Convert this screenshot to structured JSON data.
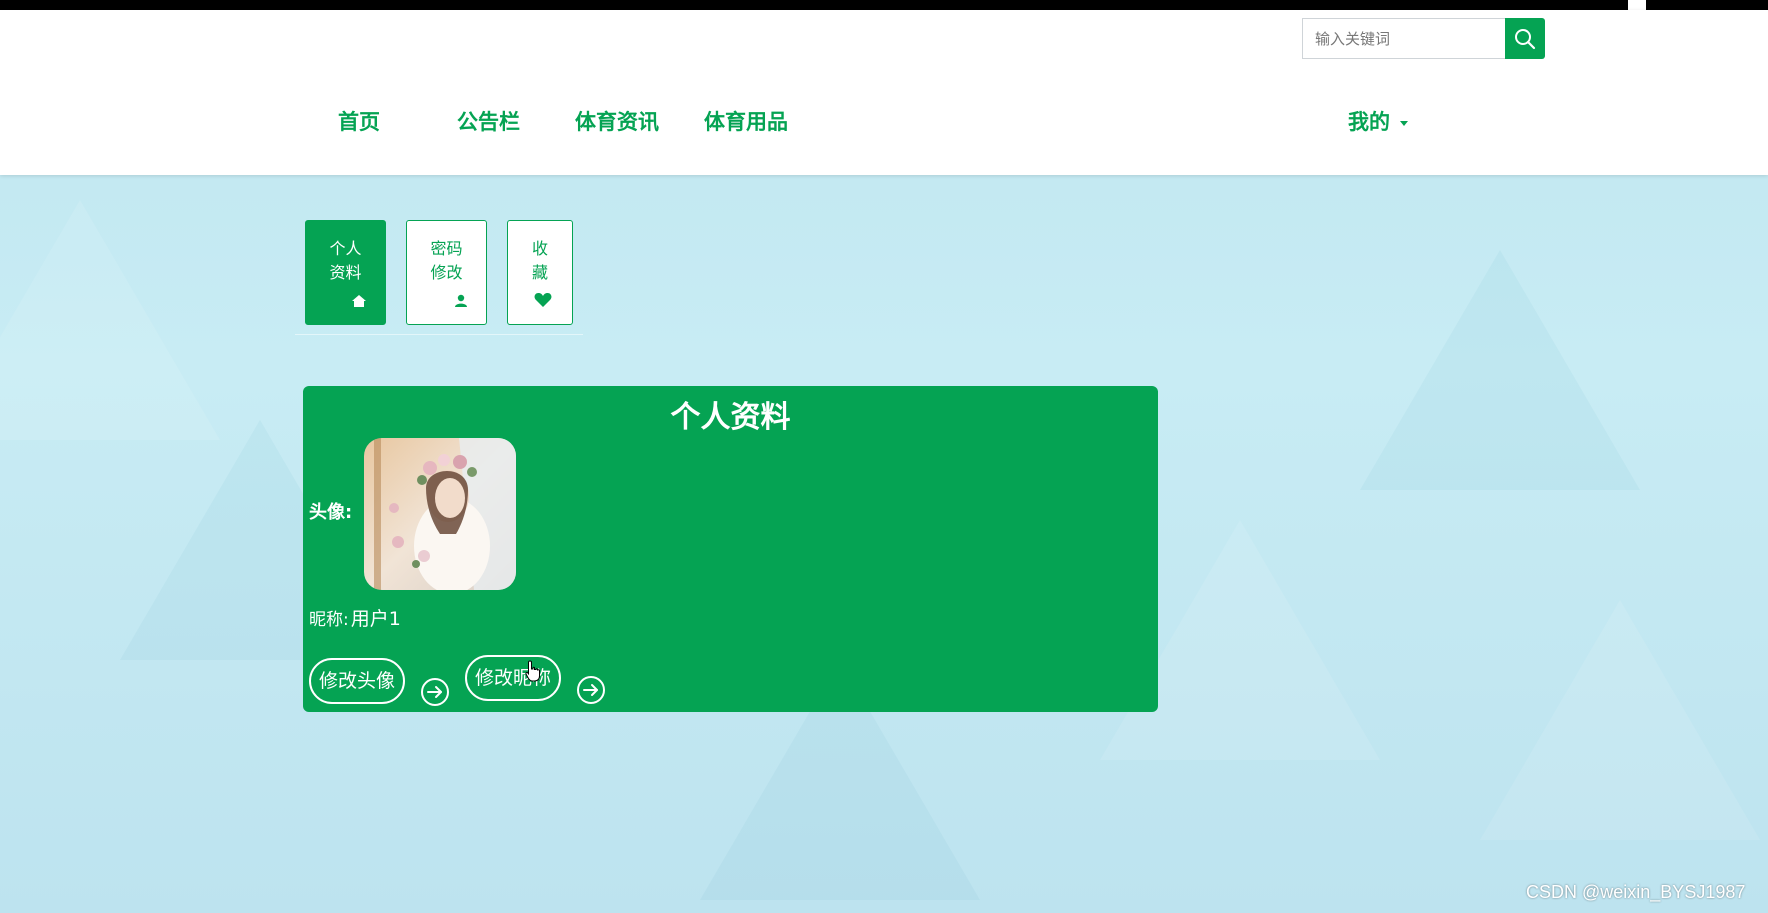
{
  "search": {
    "placeholder": "输入关键词"
  },
  "nav": {
    "items": [
      {
        "label": "首页"
      },
      {
        "label": "公告栏"
      },
      {
        "label": "体育资讯"
      },
      {
        "label": "体育用品"
      }
    ],
    "account": {
      "label": "我的"
    }
  },
  "tabs": [
    {
      "line1": "个人",
      "line2": "资料",
      "icon": "home-icon",
      "active": true
    },
    {
      "line1": "密码",
      "line2": "修改",
      "icon": "user-icon",
      "active": false
    },
    {
      "line1": "收",
      "line2": "藏",
      "icon": "heart-icon",
      "active": false
    }
  ],
  "profile": {
    "title": "个人资料",
    "avatar_label": "头像:",
    "nickname_label": "昵称:",
    "nickname_value": "用户1",
    "change_avatar_label": "修改头像",
    "change_nickname_label": "修改昵称"
  },
  "colors": {
    "accent": "#05a353",
    "header_bg": "#ffffff",
    "page_bg": "#c4e8f2"
  },
  "watermark": "CSDN @weixin_BYSJ1987"
}
